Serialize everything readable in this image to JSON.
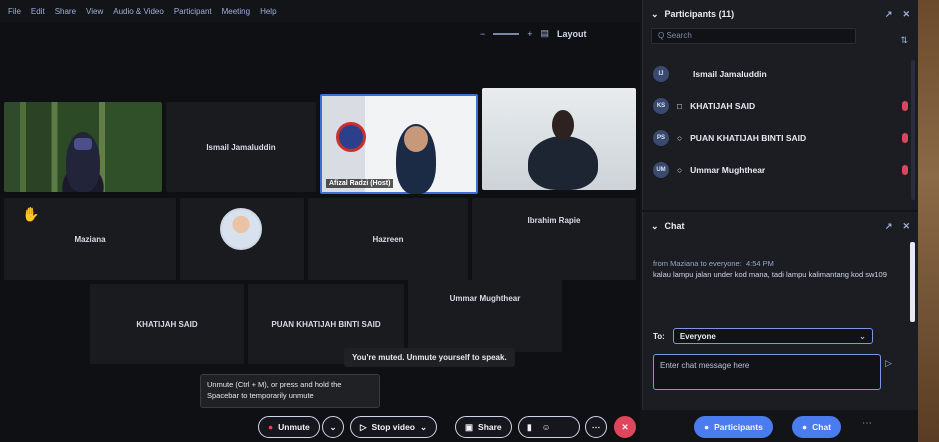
{
  "menu": [
    "File",
    "Edit",
    "Share",
    "View",
    "Audio & Video",
    "Participant",
    "Meeting",
    "Help"
  ],
  "top_controls": {
    "layout_label": "Layout"
  },
  "tiles": {
    "ismail": "Ismail Jamaluddin",
    "host": "Afizal Radzi (Host)",
    "maziana": "Maziana",
    "hazreen": "Hazreen",
    "ibrahim": "Ibrahim Rapie",
    "khatijah": "KHATIJAH SAID",
    "puan": "PUAN KHATIJAH BINTI SAID",
    "ummar": "Ummar Mughthear"
  },
  "toast": "You're muted. Unmute yourself to speak.",
  "tooltip": [
    "Unmute (Ctrl + M), or press and hold the",
    "Spacebar to temporarily unmute"
  ],
  "toolbar": {
    "unmute": "Unmute",
    "stop_video": "Stop video",
    "share": "Share",
    "participants": "Participants",
    "chat": "Chat",
    "colors": {
      "leave": "#e0465b",
      "accent": "#4a7cf0"
    }
  },
  "participants_panel": {
    "title": "Participants (11)",
    "search_placeholder": "Q Search",
    "rows": [
      {
        "initials": "IJ",
        "name": "Ismail Jamaluddin"
      },
      {
        "initials": "KS",
        "name": "KHATIJAH SAID"
      },
      {
        "initials": "PS",
        "name": "PUAN KHATIJAH BINTI SAID"
      },
      {
        "initials": "UM",
        "name": "Ummar Mughthear"
      }
    ]
  },
  "chat_panel": {
    "title": "Chat",
    "from": "from Maziana to everyone:",
    "time": "4:54 PM",
    "message": "kalau lampu jalan under kod mana, tadi lampu kalimantang kod sw109",
    "to_label": "To:",
    "to_value": "Everyone",
    "input_placeholder": "Enter chat message here"
  }
}
